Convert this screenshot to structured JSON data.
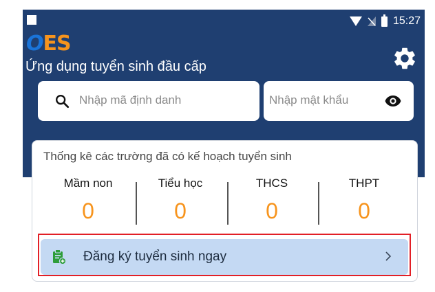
{
  "status_bar": {
    "time": "15:27"
  },
  "header": {
    "logo_o": "O",
    "logo_es": "ES",
    "subtitle": "Ứng dụng tuyển sinh đầu cấp",
    "settings_icon": "gear-icon"
  },
  "login": {
    "id_placeholder": "Nhập mã định danh",
    "password_placeholder": "Nhập mật khẩu",
    "search_icon": "search-icon",
    "eye_icon": "eye-icon"
  },
  "stats": {
    "title": "Thống kê các trường đã có kế hoạch tuyển sinh",
    "items": [
      {
        "label": "Mầm non",
        "value": "0"
      },
      {
        "label": "Tiểu học",
        "value": "0"
      },
      {
        "label": "THCS",
        "value": "0"
      },
      {
        "label": "THPT",
        "value": "0"
      }
    ]
  },
  "cta": {
    "label": "Đăng ký tuyển sinh ngay",
    "icon": "clipboard-add-icon"
  },
  "colors": {
    "header": "#1f3f71",
    "accent": "#f7941d",
    "cta_bg": "#c4d9f3",
    "highlight": "#e21f26"
  }
}
